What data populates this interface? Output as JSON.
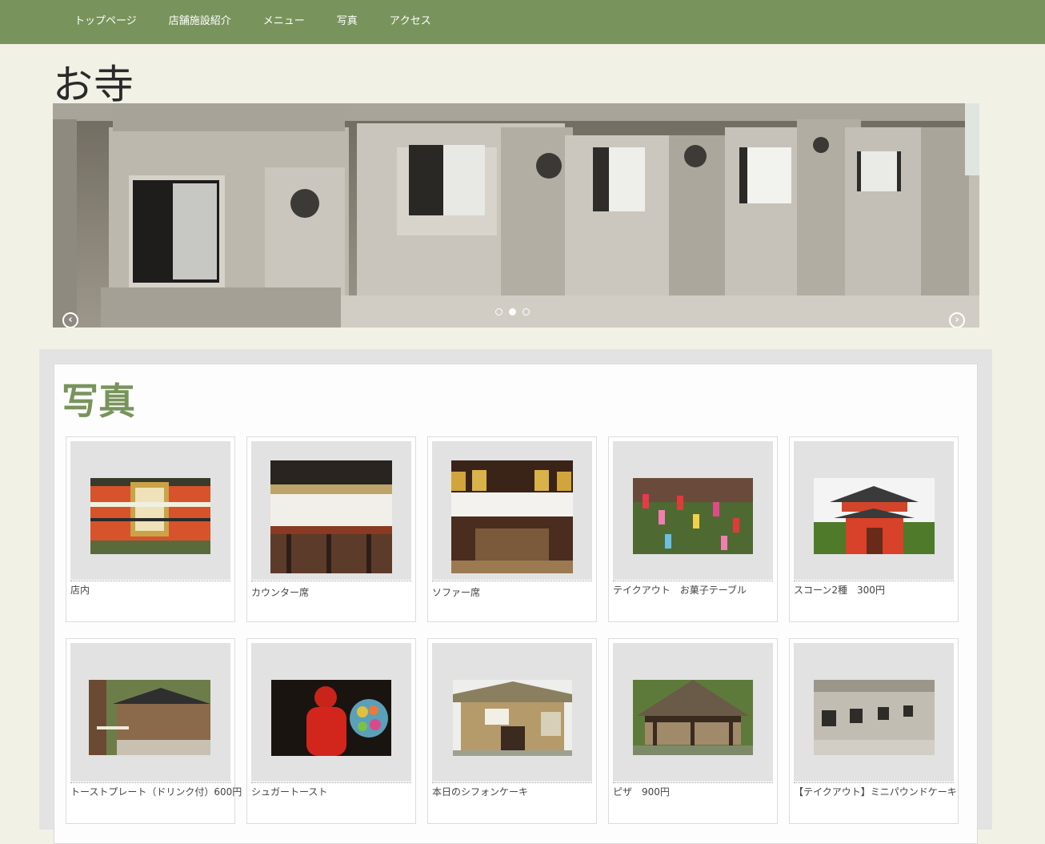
{
  "nav": {
    "items": [
      "トップページ",
      "店舗施設紹介",
      "メニュー",
      "写真",
      "アクセス"
    ]
  },
  "site": {
    "title": "お寺"
  },
  "slider": {
    "prev_icon": "chevron-left-icon",
    "next_icon": "chevron-right-icon",
    "prev_glyph": "‹",
    "next_glyph": "›",
    "slide_count": 3,
    "active_slide": 2
  },
  "section": {
    "heading": "写真"
  },
  "gallery": {
    "items": [
      {
        "caption": "店内"
      },
      {
        "caption": "カウンター席"
      },
      {
        "caption": "ソファー席"
      },
      {
        "caption": "テイクアウト　お菓子テーブル"
      },
      {
        "caption": "スコーン2種　300円"
      },
      {
        "caption": "トーストプレート（ドリンク付）600円"
      },
      {
        "caption": "シュガートースト"
      },
      {
        "caption": "本日のシフォンケーキ"
      },
      {
        "caption": "ピザ　900円"
      },
      {
        "caption": "【テイクアウト】ミニパウンドケーキ"
      }
    ]
  },
  "colors": {
    "nav_bg": "#78945c",
    "heading": "#78945c",
    "page_bg": "#f1f1e6"
  }
}
